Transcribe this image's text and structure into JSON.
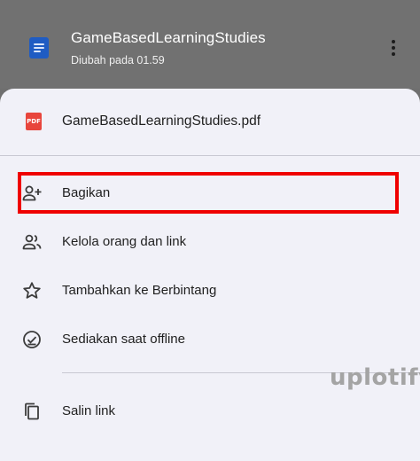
{
  "header": {
    "title": "GameBasedLearningStudies",
    "subtitle": "Diubah pada 01.59",
    "doc_icon": "docs-file-icon",
    "more_icon": "more-vert-icon"
  },
  "sheet": {
    "file": {
      "icon": "pdf-icon",
      "icon_text": "PDF",
      "name": "GameBasedLearningStudies.pdf"
    },
    "items": [
      {
        "icon": "person-add-icon",
        "label": "Bagikan",
        "highlighted": true
      },
      {
        "icon": "people-icon",
        "label": "Kelola orang dan link"
      },
      {
        "icon": "star-icon",
        "label": "Tambahkan ke Berbintang"
      },
      {
        "icon": "offline-check-icon",
        "label": "Sediakan saat offline"
      },
      {
        "icon": "copy-icon",
        "label": "Salin link"
      }
    ]
  },
  "watermark": "uplotify",
  "colors": {
    "highlight": "#ef0000",
    "pdf_red": "#e8453c",
    "docs_blue": "#1f5cc3",
    "sheet_bg": "#f1f1f8",
    "overlay": "#717171"
  }
}
